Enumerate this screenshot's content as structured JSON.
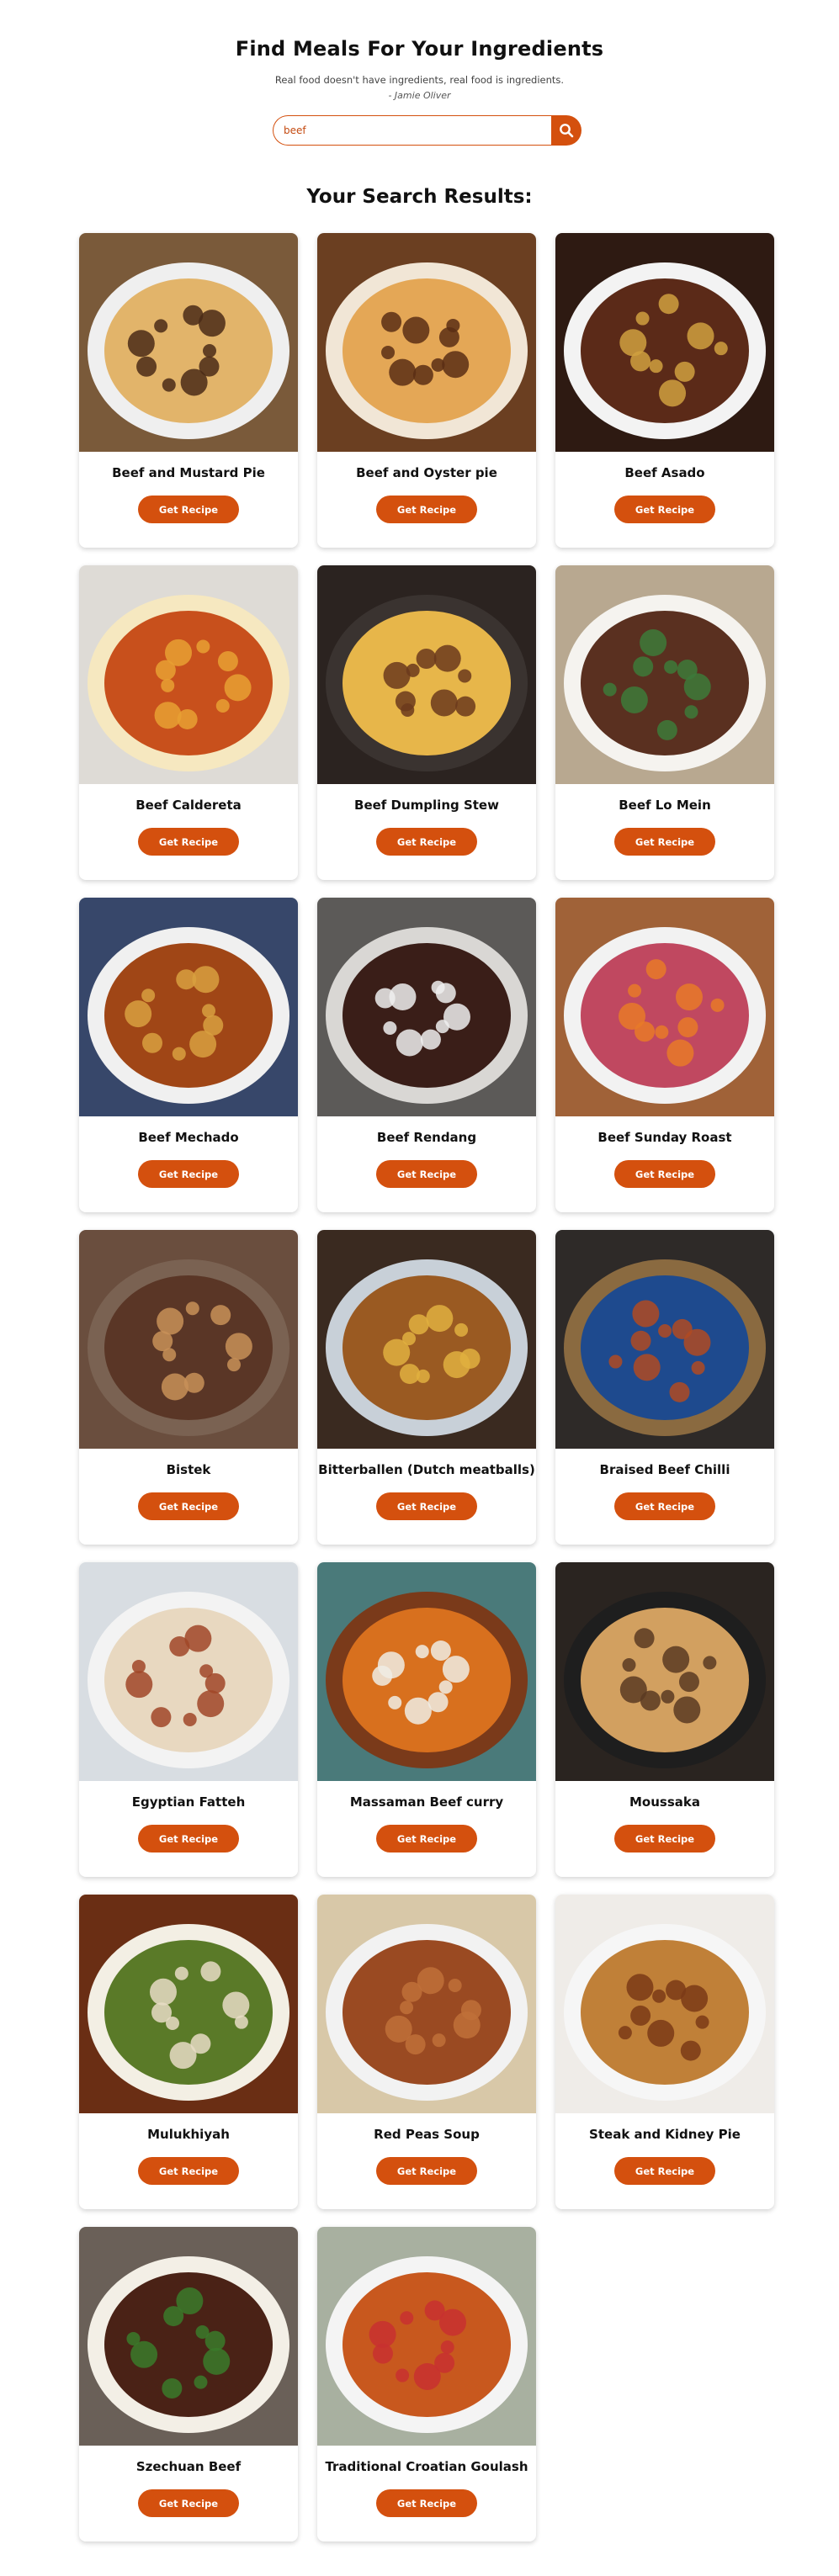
{
  "header": {
    "title": "Find Meals For Your Ingredients",
    "quote": "Real food doesn't have ingredients, real food is ingredients.",
    "author": "- Jamie Oliver"
  },
  "search": {
    "value": "beef",
    "button_icon": "search-icon"
  },
  "results_title": "Your Search Results:",
  "button_label": "Get Recipe",
  "colors": {
    "accent": "#d4500e"
  },
  "meals": [
    {
      "name": "Beef and Mustard Pie",
      "bg": "#7a5a3a",
      "dish": "#e2b46a",
      "accent": "#4a2a16",
      "plate": "#efefef"
    },
    {
      "name": "Beef and Oyster pie",
      "bg": "#6b3f21",
      "dish": "#e4a756",
      "accent": "#5a2e14",
      "plate": "#f1e6d6"
    },
    {
      "name": "Beef Asado",
      "bg": "#2e1a12",
      "dish": "#5b2a18",
      "accent": "#d0a040",
      "plate": "#f3f3f3"
    },
    {
      "name": "Beef Caldereta",
      "bg": "#dedbd6",
      "dish": "#c8501c",
      "accent": "#e8a033",
      "plate": "#f6e8c0"
    },
    {
      "name": "Beef Dumpling Stew",
      "bg": "#2b2320",
      "dish": "#e7b64a",
      "accent": "#6b3a1c",
      "plate": "#3a3330"
    },
    {
      "name": "Beef Lo Mein",
      "bg": "#b8a890",
      "dish": "#5a3020",
      "accent": "#3d7a3a",
      "plate": "#f5f3ef"
    },
    {
      "name": "Beef Mechado",
      "bg": "#37476a",
      "dish": "#a04616",
      "accent": "#d8a040",
      "plate": "#f0f0f0"
    },
    {
      "name": "Beef Rendang",
      "bg": "#5c5a58",
      "dish": "#3a1e18",
      "accent": "#efefef",
      "plate": "#d9d7d4"
    },
    {
      "name": "Beef Sunday Roast",
      "bg": "#a06238",
      "dish": "#c04860",
      "accent": "#e87a28",
      "plate": "#f2f2f2"
    },
    {
      "name": "Bistek",
      "bg": "#6a4e3e",
      "dish": "#5a3626",
      "accent": "#c89058",
      "plate": "#7a6252"
    },
    {
      "name": "Bitterballen (Dutch meatballs)",
      "bg": "#3a2a20",
      "dish": "#9a5a22",
      "accent": "#e0b040",
      "plate": "#c8d0d8"
    },
    {
      "name": "Braised Beef Chilli",
      "bg": "#2e2a28",
      "dish": "#1e4a8e",
      "accent": "#b04a22",
      "plate": "#8a6a40"
    },
    {
      "name": "Egyptian Fatteh",
      "bg": "#d8dde2",
      "dish": "#e8d8c0",
      "accent": "#a04628",
      "plate": "#f3f3f3"
    },
    {
      "name": "Massaman Beef curry",
      "bg": "#4a7a7a",
      "dish": "#d8701e",
      "accent": "#f0ece4",
      "plate": "#7a3a1a"
    },
    {
      "name": "Moussaka",
      "bg": "#2a2420",
      "dish": "#d2a060",
      "accent": "#5a3a22",
      "plate": "#1e1e1e"
    },
    {
      "name": "Mulukhiyah",
      "bg": "#6a2e14",
      "dish": "#5a7a28",
      "accent": "#e8dcc4",
      "plate": "#f3efe4"
    },
    {
      "name": "Red Peas Soup",
      "bg": "#d8c8a8",
      "dish": "#9a4a22",
      "accent": "#c07038",
      "plate": "#f2f2f2"
    },
    {
      "name": "Steak and Kidney Pie",
      "bg": "#efece8",
      "dish": "#c08038",
      "accent": "#7a3a16",
      "plate": "#f6f6f6"
    },
    {
      "name": "Szechuan Beef",
      "bg": "#6a6058",
      "dish": "#4a2216",
      "accent": "#3a7a2a",
      "plate": "#f3efe6"
    },
    {
      "name": "Traditional Croatian Goulash",
      "bg": "#a8b0a0",
      "dish": "#c8581e",
      "accent": "#c83030",
      "plate": "#f4f4f4"
    }
  ]
}
